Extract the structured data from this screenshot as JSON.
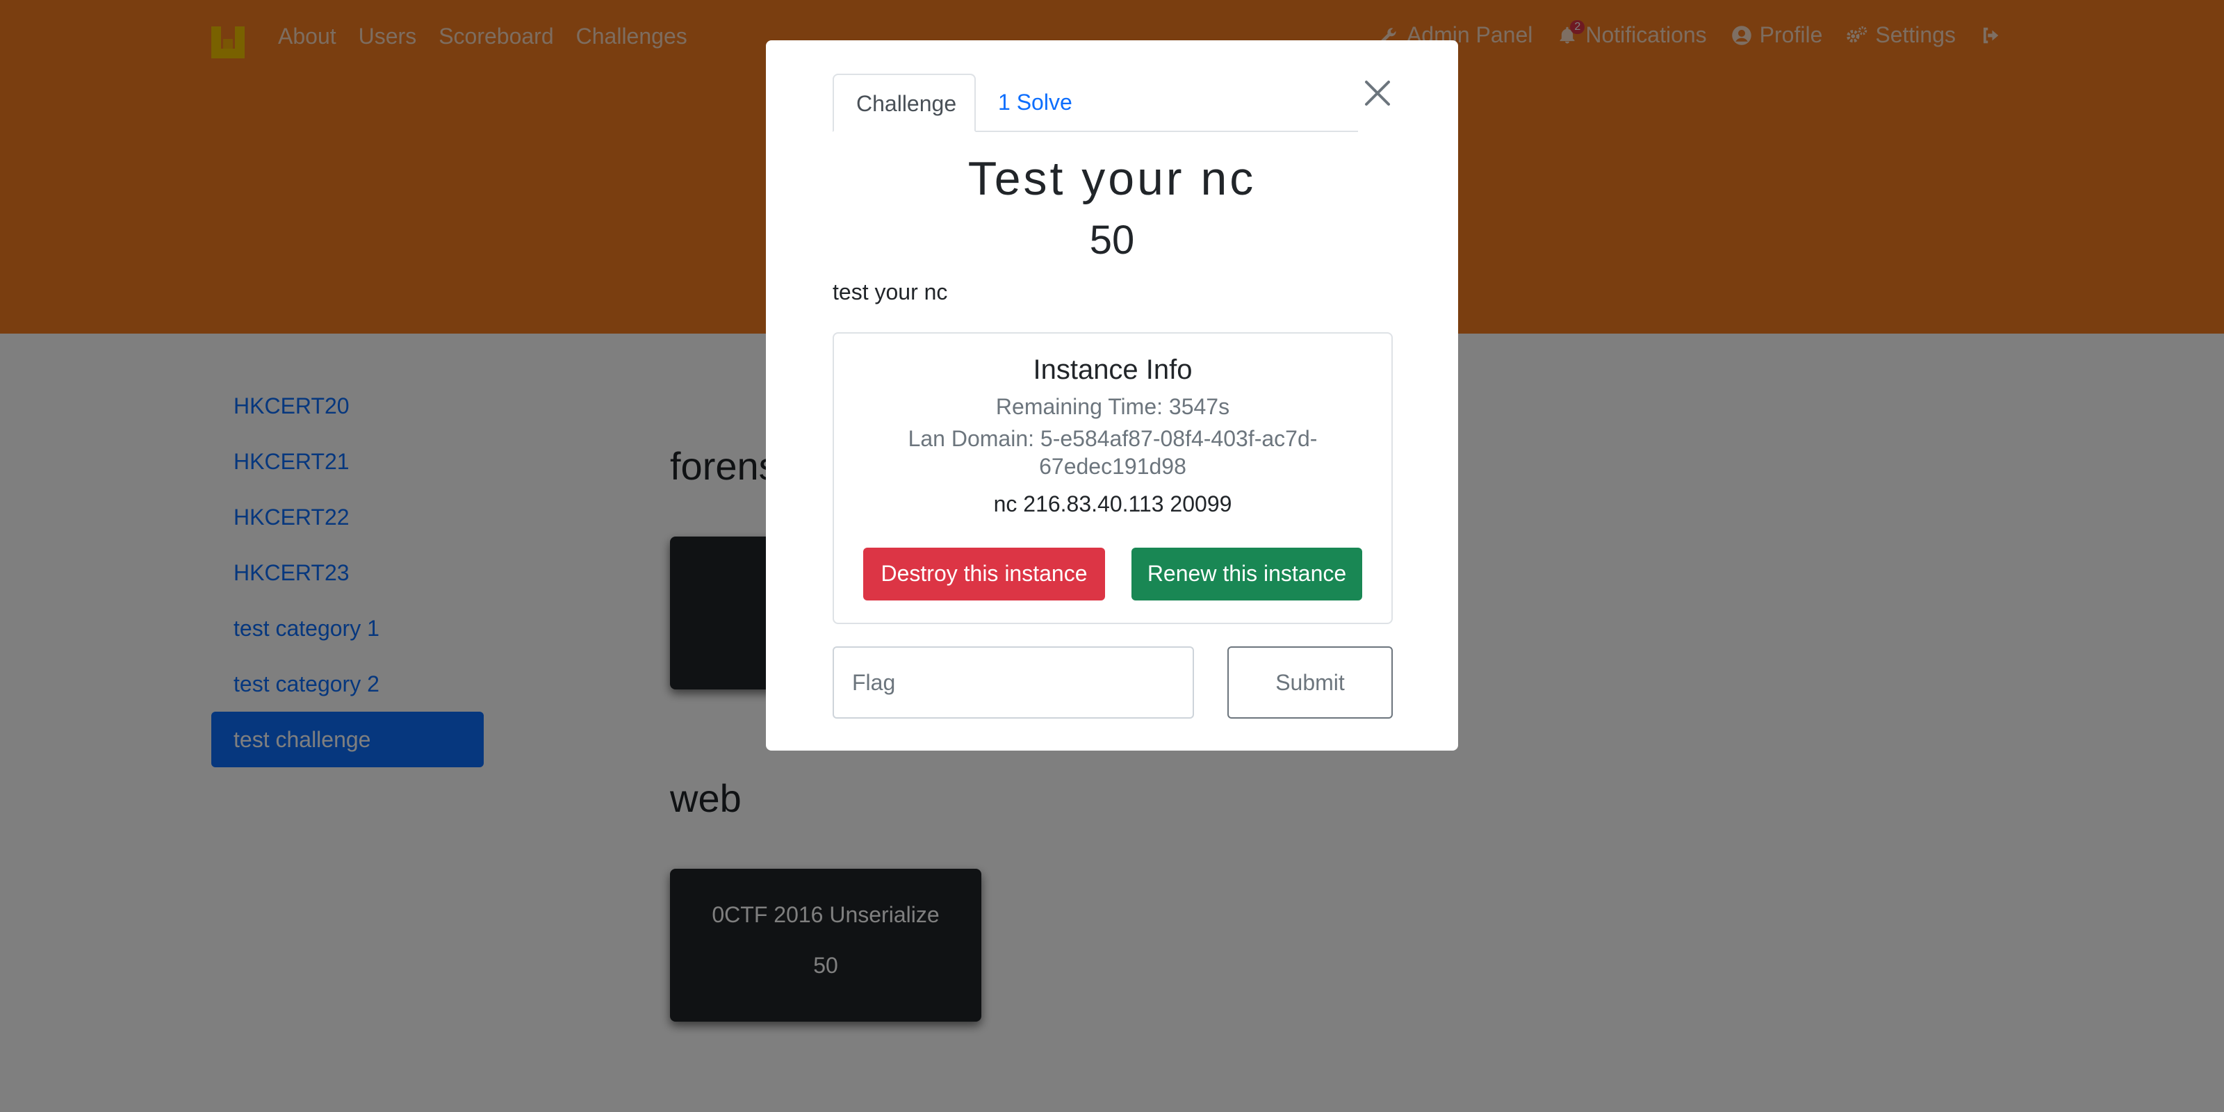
{
  "navbar": {
    "left_links": [
      "About",
      "Users",
      "Scoreboard",
      "Challenges"
    ],
    "admin_label": "Admin Panel",
    "notifications_label": "Notifications",
    "notifications_count": "2",
    "profile_label": "Profile",
    "settings_label": "Settings"
  },
  "sidebar": {
    "items": [
      {
        "label": "HKCERT20"
      },
      {
        "label": "HKCERT21"
      },
      {
        "label": "HKCERT22"
      },
      {
        "label": "HKCERT23"
      },
      {
        "label": "test category 1"
      },
      {
        "label": "test category 2"
      },
      {
        "label": "test challenge",
        "active": true
      }
    ]
  },
  "main": {
    "categories": [
      {
        "title": "forensics"
      },
      {
        "title": "web",
        "challenges": [
          {
            "name": "0CTF 2016 Unserialize",
            "value": "50"
          }
        ]
      }
    ]
  },
  "modal": {
    "tabs": [
      "Challenge",
      "1 Solve"
    ],
    "challenge_name": "Test your nc",
    "challenge_value": "50",
    "description": "test your nc",
    "instance": {
      "title": "Instance Info",
      "remaining": "Remaining Time: 3547s",
      "lan_domain": "Lan Domain: 5-e584af87-08f4-403f-ac7d-67edec191d98",
      "connection": "nc 216.83.40.113 20099",
      "destroy_label": "Destroy this instance",
      "renew_label": "Renew this instance"
    },
    "flag_placeholder": "Flag",
    "submit_label": "Submit"
  },
  "colors": {
    "navbar": "#f47c20",
    "primary": "#0d6efd",
    "danger": "#dc3545",
    "success": "#198754",
    "card": "#212529"
  }
}
